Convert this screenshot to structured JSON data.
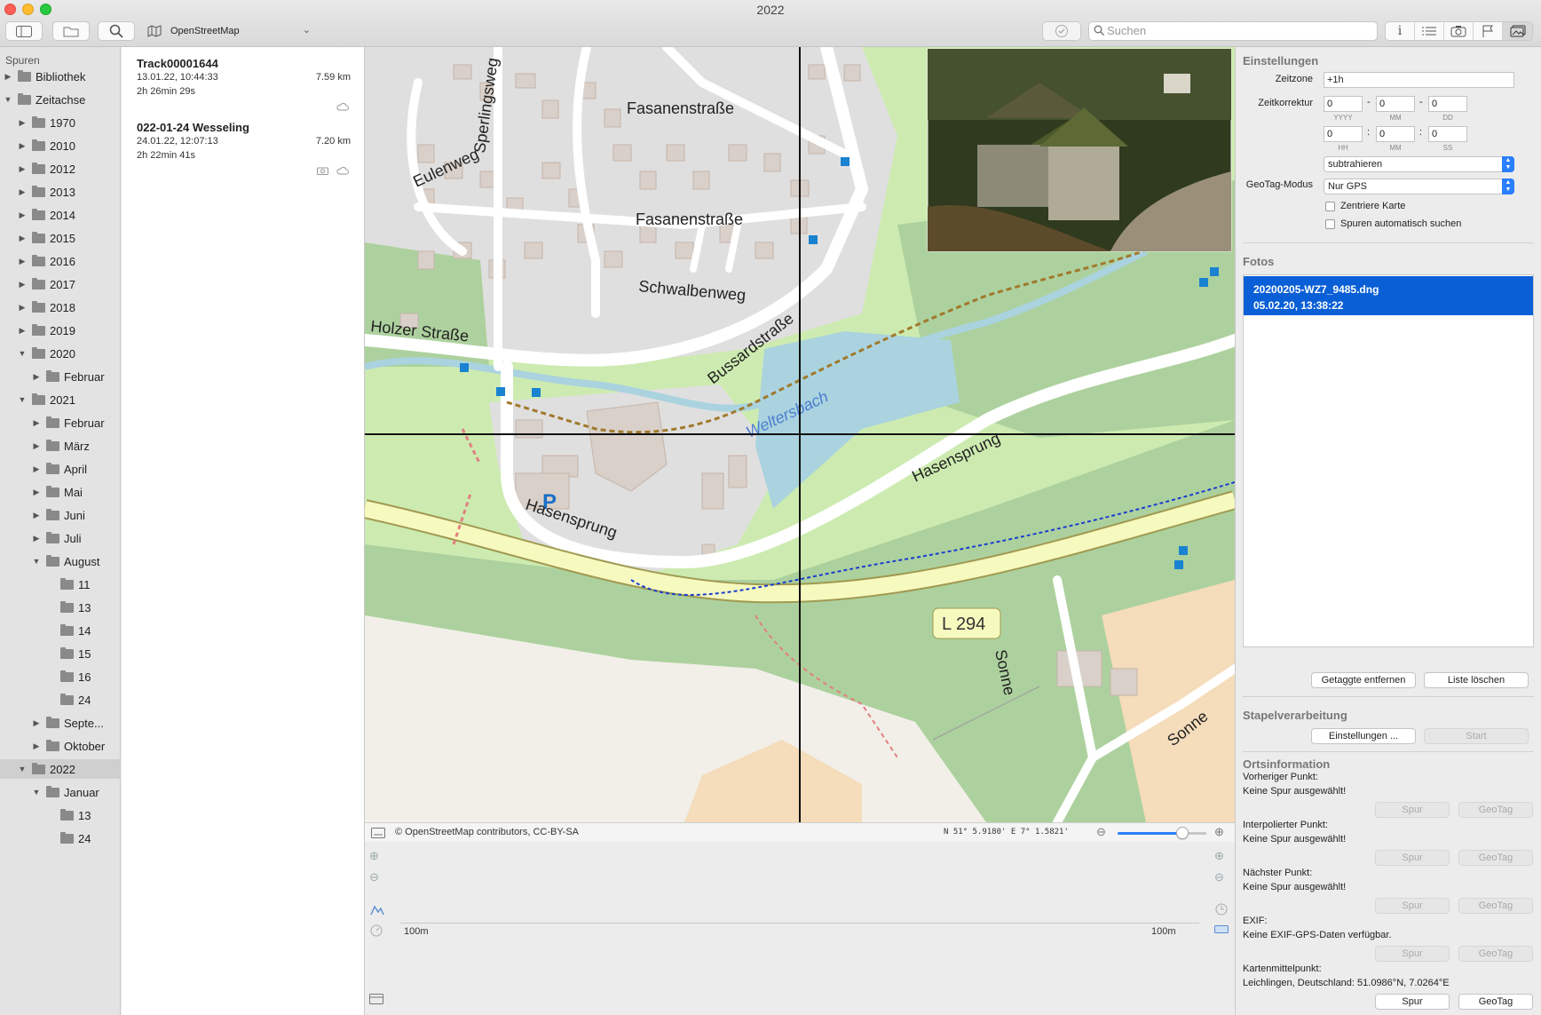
{
  "window": {
    "title": "2022"
  },
  "toolbar": {
    "map_source": "OpenStreetMap",
    "search_placeholder": "Suchen"
  },
  "sidebar": {
    "header": "Spuren",
    "items": [
      {
        "label": "Bibliothek",
        "level": 0,
        "expanded": false
      },
      {
        "label": "Zeitachse",
        "level": 0,
        "expanded": true,
        "no_folder": false
      },
      {
        "label": "1970",
        "level": 1,
        "expanded": false
      },
      {
        "label": "2010",
        "level": 1,
        "expanded": false
      },
      {
        "label": "2012",
        "level": 1,
        "expanded": false
      },
      {
        "label": "2013",
        "level": 1,
        "expanded": false
      },
      {
        "label": "2014",
        "level": 1,
        "expanded": false
      },
      {
        "label": "2015",
        "level": 1,
        "expanded": false
      },
      {
        "label": "2016",
        "level": 1,
        "expanded": false
      },
      {
        "label": "2017",
        "level": 1,
        "expanded": false
      },
      {
        "label": "2018",
        "level": 1,
        "expanded": false
      },
      {
        "label": "2019",
        "level": 1,
        "expanded": false
      },
      {
        "label": "2020",
        "level": 1,
        "expanded": true
      },
      {
        "label": "Februar",
        "level": 2,
        "expanded": false
      },
      {
        "label": "2021",
        "level": 1,
        "expanded": true
      },
      {
        "label": "Februar",
        "level": 2,
        "expanded": false
      },
      {
        "label": "März",
        "level": 2,
        "expanded": false
      },
      {
        "label": "April",
        "level": 2,
        "expanded": false
      },
      {
        "label": "Mai",
        "level": 2,
        "expanded": false
      },
      {
        "label": "Juni",
        "level": 2,
        "expanded": false
      },
      {
        "label": "Juli",
        "level": 2,
        "expanded": false
      },
      {
        "label": "August",
        "level": 2,
        "expanded": true
      },
      {
        "label": "11",
        "level": 3
      },
      {
        "label": "13",
        "level": 3
      },
      {
        "label": "14",
        "level": 3
      },
      {
        "label": "15",
        "level": 3
      },
      {
        "label": "16",
        "level": 3
      },
      {
        "label": "24",
        "level": 3
      },
      {
        "label": "Septe...",
        "level": 2,
        "expanded": false
      },
      {
        "label": "Oktober",
        "level": 2,
        "expanded": false
      },
      {
        "label": "2022",
        "level": 1,
        "expanded": true,
        "selected": true
      },
      {
        "label": "Januar",
        "level": 2,
        "expanded": true
      },
      {
        "label": "13",
        "level": 3
      },
      {
        "label": "24",
        "level": 3
      }
    ]
  },
  "tracks": [
    {
      "name": "Track00001644",
      "date": "13.01.22, 10:44:33",
      "duration": "2h 26min 29s",
      "distance": "7.59 km",
      "icons": [
        "cloud-icon"
      ]
    },
    {
      "name": "022-01-24 Wesseling",
      "date": "24.01.22, 12:07:13",
      "duration": "2h 22min 41s",
      "distance": "7.20 km",
      "icons": [
        "camera-icon",
        "cloud-icon"
      ]
    }
  ],
  "map": {
    "labels": {
      "fasanen1": "Fasanenstraße",
      "fasanen2": "Fasanenstraße",
      "sperlingsweg": "Sperlingsweg",
      "eulenweg": "Eulenweg",
      "schwalbenweg": "Schwalbenweg",
      "holzer": "Holzer Straße",
      "bussard": "Bussardstraße",
      "weltersbach": "Weltersbach",
      "hasensprung1": "Hasensprung",
      "hasensprung2": "Hasensprung",
      "l294": "L 294",
      "sonne1": "Sonne",
      "sonne2": "Sonne",
      "parking": "P"
    },
    "attribution": "© OpenStreetMap contributors, CC-BY-SA",
    "coordinates": "N 51° 5.9180' E 7° 1.5821'",
    "zoom_level": 0.72
  },
  "profile": {
    "scale_left": "100m",
    "scale_right": "100m"
  },
  "settings": {
    "title": "Einstellungen",
    "timezone_label": "Zeitzone",
    "timezone_value": "+1h",
    "correction_label": "Zeitkorrektur",
    "date_fields": [
      "0",
      "0",
      "0"
    ],
    "date_units": [
      "YYYY",
      "MM",
      "DD"
    ],
    "time_fields": [
      "0",
      "0",
      "0"
    ],
    "time_units": [
      "HH",
      "MM",
      "SS"
    ],
    "op_value": "subtrahieren",
    "geotag_mode_label": "GeoTag-Modus",
    "geotag_mode_value": "Nur GPS",
    "center_map": "Zentriere Karte",
    "auto_search": "Spuren automatisch suchen"
  },
  "photos": {
    "title": "Fotos",
    "selected_name": "20200205-WZ7_9485.dng",
    "selected_date": "05.02.20, 13:38:22",
    "remove_tagged": "Getaggte entfernen",
    "clear_list": "Liste löschen"
  },
  "batch": {
    "title": "Stapelverarbeitung",
    "settings_btn": "Einstellungen ...",
    "start_btn": "Start"
  },
  "location": {
    "title": "Ortsinformation",
    "prev_label": "Vorheriger Punkt:",
    "prev_value": "Keine Spur ausgewählt!",
    "interp_label": "Interpolierter Punkt:",
    "interp_value": "Keine Spur ausgewählt!",
    "next_label": "Nächster Punkt:",
    "next_value": "Keine Spur ausgewählt!",
    "exif_label": "EXIF:",
    "exif_value": "Keine EXIF-GPS-Daten verfügbar.",
    "center_label": "Kartenmittelpunkt:",
    "center_value": "Leichlingen, Deutschland: 51.0986°N, 7.0264°E",
    "track_btn": "Spur",
    "geotag_btn": "GeoTag"
  },
  "colors": {
    "accent": "#0a5fd6",
    "map_green": "#cdebb0",
    "road_yellow": "#f7fabf",
    "water": "#aad3df"
  }
}
